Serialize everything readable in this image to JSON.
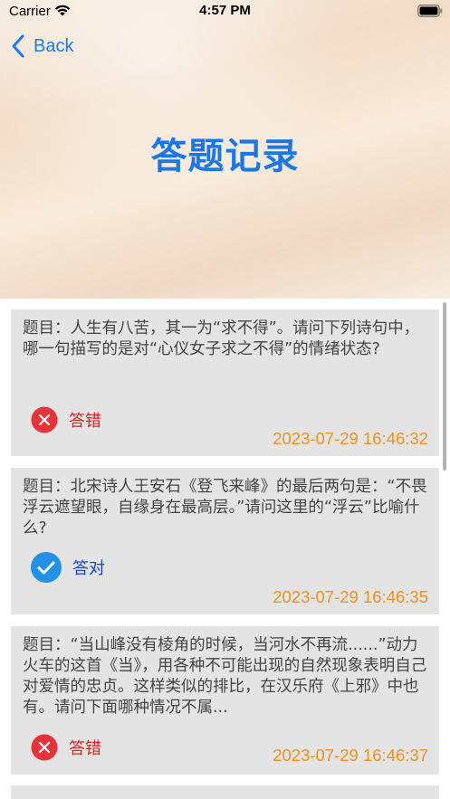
{
  "status_bar": {
    "carrier": "Carrier",
    "time": "4:57 PM"
  },
  "nav": {
    "back_label": "Back"
  },
  "page": {
    "title": "答题记录"
  },
  "records": [
    {
      "question": "题目：人生有八苦，其一为“求不得”。请问下列诗句中，哪一句描写的是对“心仪女子求之不得”的情绪状态?",
      "result_label": "答错",
      "correct": false,
      "timestamp": "2023-07-29 16:46:32"
    },
    {
      "question": "题目：北宋诗人王安石《登飞来峰》的最后两句是：“不畏浮云遮望眼，自缘身在最高层。”请问这里的“浮云”比喻什么?",
      "result_label": "答对",
      "correct": true,
      "timestamp": "2023-07-29 16:46:35"
    },
    {
      "question": "题目：“当山峰没有棱角的时候，当河水不再流......”动力火车的这首《当》，用各种不可能出现的自然现象表明自己对爱情的忠贞。这样类似的排比，在汉乐府《上邪》中也有。请问下面哪种情况不属...",
      "result_label": "答错",
      "correct": false,
      "timestamp": "2023-07-29 16:46:37"
    }
  ],
  "colors": {
    "accent": "#1b77e4",
    "wrong": "#e02020",
    "right": "#1a3ed8",
    "timestamp": "#f0901e",
    "card_bg": "#e4e4e4"
  }
}
